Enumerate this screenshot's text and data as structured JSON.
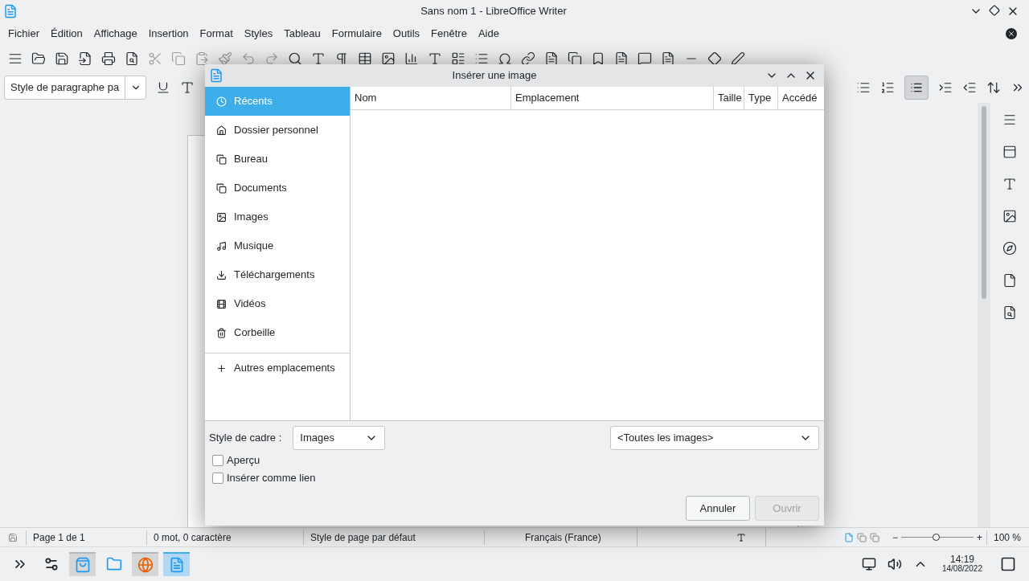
{
  "window": {
    "title": "Sans nom 1 - LibreOffice Writer"
  },
  "menu": [
    "Fichier",
    "Édition",
    "Affichage",
    "Insertion",
    "Format",
    "Styles",
    "Tableau",
    "Formulaire",
    "Outils",
    "Fenêtre",
    "Aide"
  ],
  "paragraph_style": {
    "value": "Style de paragraphe pa"
  },
  "dialog": {
    "title": "Insérer une image",
    "places": [
      {
        "label": "Récents",
        "kind": "clock",
        "selected": true
      },
      {
        "label": "Dossier personnel",
        "kind": "home",
        "selected": false
      },
      {
        "label": "Bureau",
        "kind": "copy",
        "selected": false
      },
      {
        "label": "Documents",
        "kind": "copy",
        "selected": false
      },
      {
        "label": "Images",
        "kind": "image",
        "selected": false
      },
      {
        "label": "Musique",
        "kind": "music",
        "selected": false
      },
      {
        "label": "Téléchargements",
        "kind": "download",
        "selected": false
      },
      {
        "label": "Vidéos",
        "kind": "film",
        "selected": false
      },
      {
        "label": "Corbeille",
        "kind": "trash",
        "selected": false
      }
    ],
    "other_places": "Autres emplacements",
    "columns": [
      "Nom",
      "Emplacement",
      "Taille",
      "Type",
      "Accédé"
    ],
    "frame_style": {
      "label": "Style de cadre :",
      "value": "Images"
    },
    "filter": {
      "value": "<Toutes les images>"
    },
    "options": [
      {
        "label": "Aperçu",
        "checked": false
      },
      {
        "label": "Insérer comme lien",
        "checked": false
      }
    ],
    "buttons": [
      {
        "label": "Annuler",
        "disabled": false
      },
      {
        "label": "Ouvrir",
        "disabled": true
      }
    ]
  },
  "status_bar": {
    "page": "Page 1 de 1",
    "words": "0 mot, 0 caractère",
    "page_style": "Style de page par défaut",
    "language": "Français (France)",
    "zoom": {
      "minus": "−",
      "plus": "+",
      "level": 0.48,
      "reading": "100 %"
    }
  },
  "taskbar": {
    "apps": [
      {
        "kind": "launcher",
        "open": false,
        "selected": false
      },
      {
        "kind": "settings",
        "open": false,
        "selected": false
      },
      {
        "kind": "store",
        "open": true,
        "selected": false
      },
      {
        "kind": "folder",
        "open": false,
        "selected": false
      },
      {
        "kind": "browser",
        "open": true,
        "selected": false
      },
      {
        "kind": "writer",
        "open": true,
        "selected": true
      }
    ],
    "time": "14:19",
    "date": "14/08/2022"
  }
}
